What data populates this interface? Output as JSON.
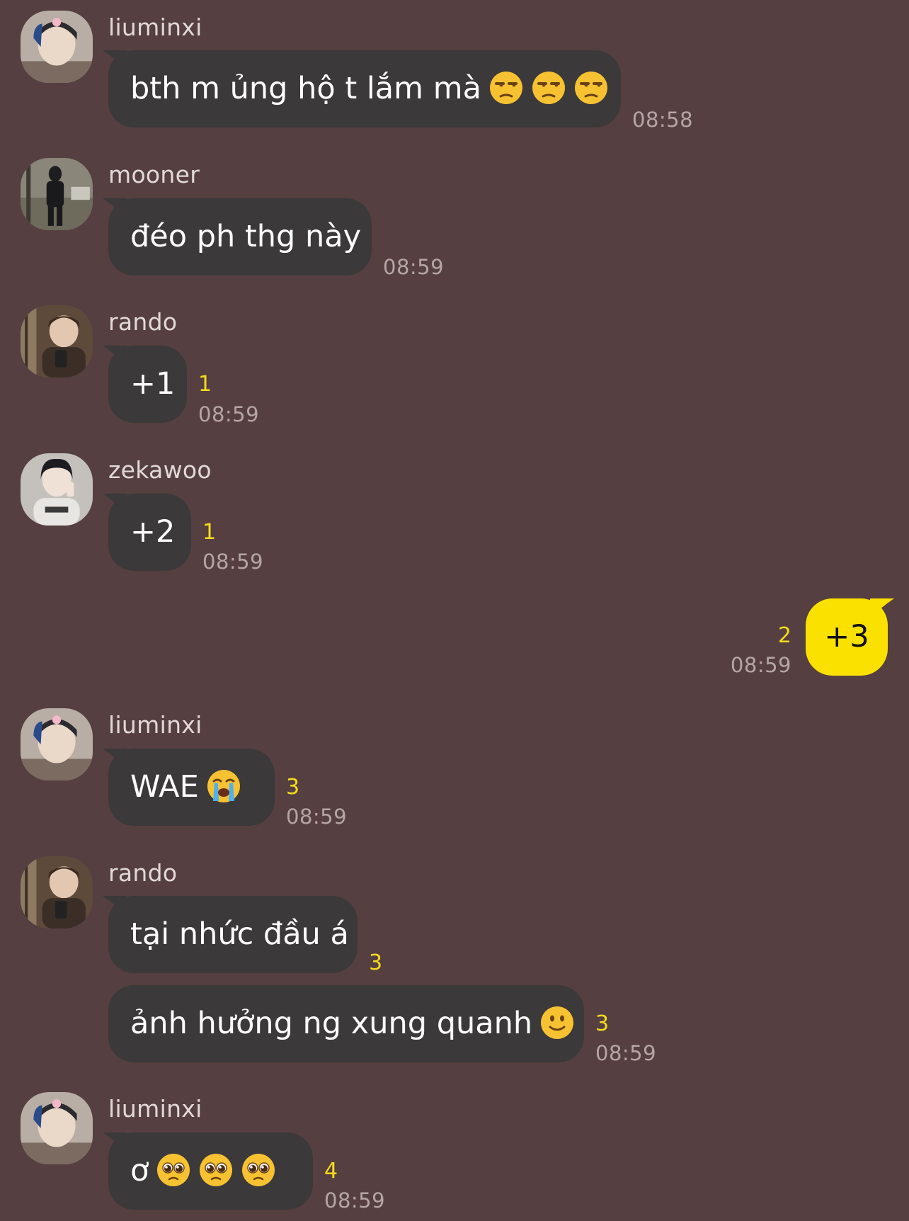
{
  "messages": [
    {
      "sender": "liuminxi",
      "text": "bth m ủng hộ t lắm mà",
      "emojis": [
        "unamused-face",
        "unamused-face",
        "unamused-face"
      ],
      "time": "08:58"
    },
    {
      "sender": "mooner",
      "text": "đéo ph thg này",
      "time": "08:59"
    },
    {
      "sender": "rando",
      "text": "+1",
      "unread": "1",
      "time": "08:59"
    },
    {
      "sender": "zekawoo",
      "text": "+2",
      "unread": "1",
      "time": "08:59"
    },
    {
      "sender": "me",
      "text": "+3",
      "unread": "2",
      "time": "08:59"
    },
    {
      "sender": "liuminxi",
      "text": "WAE",
      "emojis": [
        "loudly-crying-face"
      ],
      "unread": "3",
      "time": "08:59"
    },
    {
      "sender": "rando",
      "text": "tại nhức đầu á",
      "unread": "3"
    },
    {
      "sender": "rando",
      "text": "ảnh hưởng ng xung quanh",
      "emojis": [
        "slightly-smiling-face"
      ],
      "unread": "3",
      "time": "08:59"
    },
    {
      "sender": "liuminxi",
      "text": "ơ",
      "emojis": [
        "pleading-face",
        "pleading-face",
        "pleading-face"
      ],
      "unread": "4",
      "time": "08:59"
    }
  ],
  "colors": {
    "background": "#553f41",
    "bubble_incoming": "#3b393a",
    "bubble_outgoing": "#fae100",
    "unread_count": "#f5dc1a",
    "timestamp": "#b5a5a6"
  }
}
